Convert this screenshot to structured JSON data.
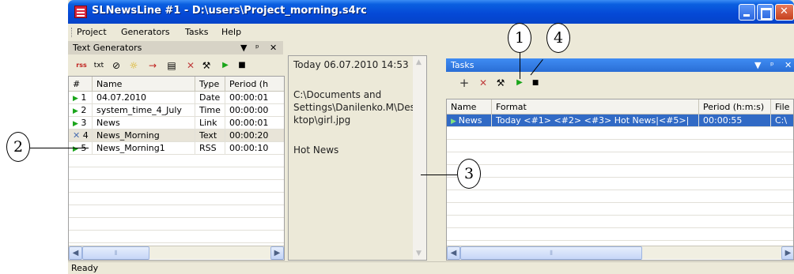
{
  "window": {
    "title": "SLNewsLine #1 - D:\\users\\Project_morning.s4rc"
  },
  "menu": [
    "Project",
    "Generators",
    "Tasks",
    "Help"
  ],
  "text_generators": {
    "title": "Text Generators",
    "controls": [
      "▼",
      "ᵖ",
      "✕"
    ],
    "toolbar_icons": [
      "rss-add-icon",
      "txt-add-icon",
      "clock-add-icon",
      "sun-add-icon",
      "link-add-icon",
      "calendar-add-icon",
      "delete-icon",
      "tools-icon",
      "play-icon",
      "stop-icon"
    ],
    "columns": [
      "#",
      "Name",
      "Type",
      "Period (h"
    ],
    "rows": [
      {
        "num": "1",
        "name": "04.07.2010",
        "type": "Date",
        "period": "00:00:01",
        "state": "play"
      },
      {
        "num": "2",
        "name": "system_time_4_July",
        "type": "Time",
        "period": "00:00:00",
        "state": "play"
      },
      {
        "num": "3",
        "name": "News",
        "type": "Link",
        "period": "00:00:01",
        "state": "play"
      },
      {
        "num": "4",
        "name": "News_Morning",
        "type": "Text",
        "period": "00:00:20",
        "state": "error"
      },
      {
        "num": "5",
        "name": "News_Morning1",
        "type": "RSS",
        "period": "00:00:10",
        "state": "play"
      }
    ]
  },
  "preview": {
    "line1": "Today 06.07.2010 14:53",
    "line2": "C:\\Documents and",
    "line3": "Settings\\Danilenko.M\\Des",
    "line4": "ktop\\girl.jpg",
    "line5": "Hot News"
  },
  "tasks": {
    "title": "Tasks",
    "controls": [
      "▼",
      "ᵖ",
      "✕"
    ],
    "toolbar_icons": [
      "add-icon",
      "delete-icon",
      "tools-icon",
      "play-icon",
      "stop-icon"
    ],
    "columns": [
      "Name",
      "Format",
      "Period (h:m:s)",
      "File"
    ],
    "rows": [
      {
        "name": "News",
        "format": "Today <#1> <#2> <#3> Hot News|<#5>|",
        "period": "00:00:55",
        "file": "C:\\"
      }
    ]
  },
  "status": "Ready",
  "callouts": [
    "1",
    "2",
    "3",
    "4"
  ]
}
